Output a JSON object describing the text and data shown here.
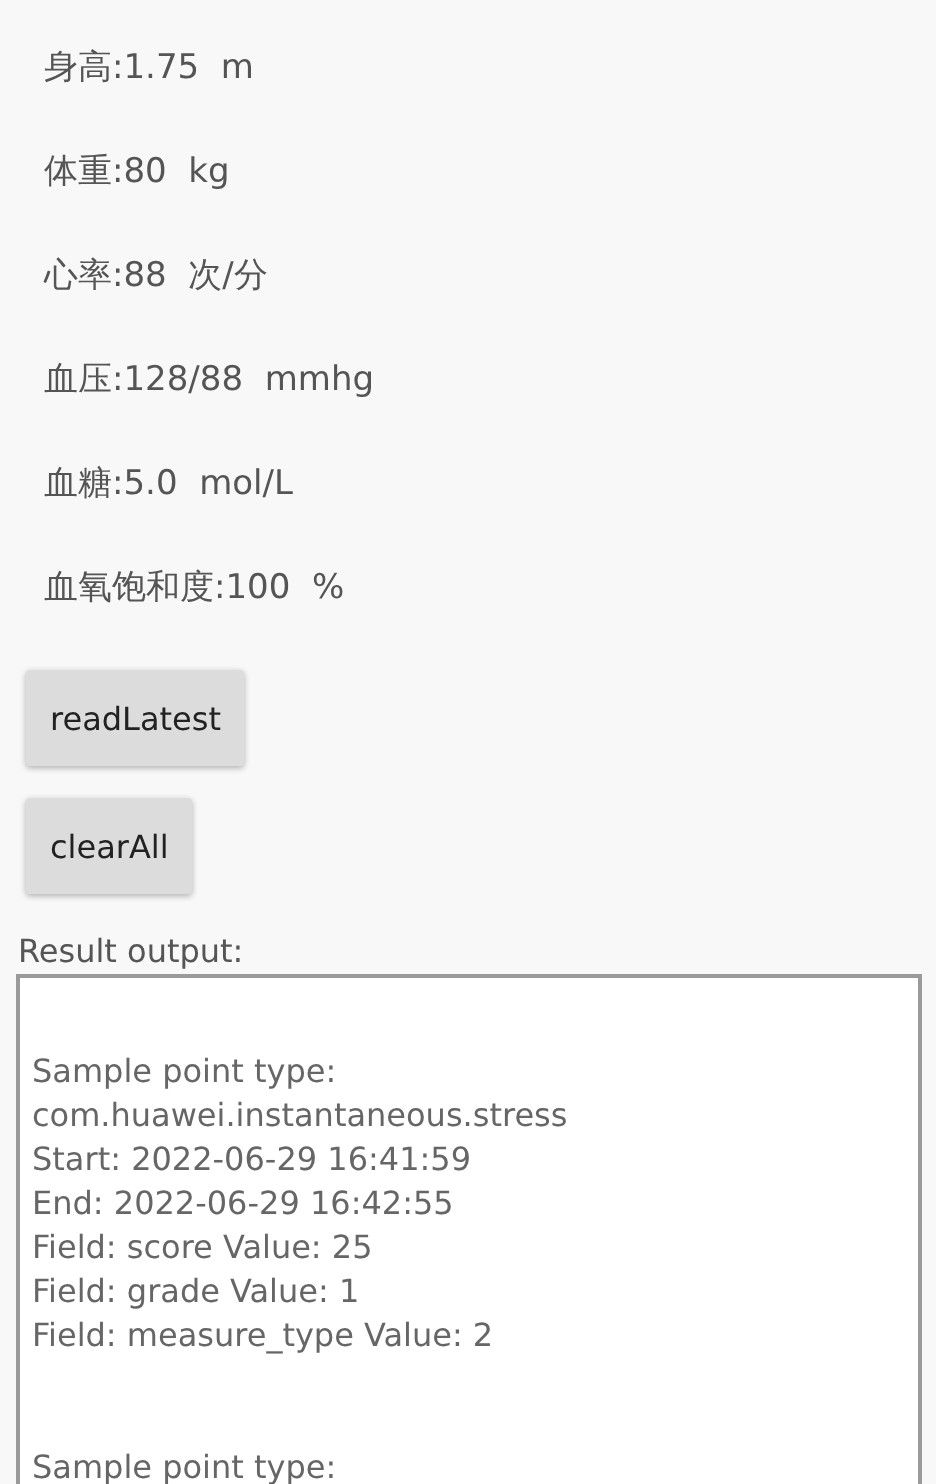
{
  "readings": [
    {
      "text": "身高:1.75  m"
    },
    {
      "text": "体重:80  kg"
    },
    {
      "text": "心率:88  次/分"
    },
    {
      "text": "血压:128/88  mmhg"
    },
    {
      "text": "血糖:5.0  mol/L"
    },
    {
      "text": "血氧饱和度:100  %"
    }
  ],
  "buttons": [
    "readLatest",
    "clearAll"
  ],
  "output": {
    "label": "Result output:",
    "blocks": [
      [
        "Sample point type:",
        "com.huawei.instantaneous.stress",
        "Start: 2022-06-29 16:41:59",
        "End: 2022-06-29 16:42:55",
        "Field: score Value: 25",
        "Field: grade Value: 1",
        "Field: measure_type Value: 2"
      ],
      [
        "Sample point type:"
      ]
    ]
  }
}
